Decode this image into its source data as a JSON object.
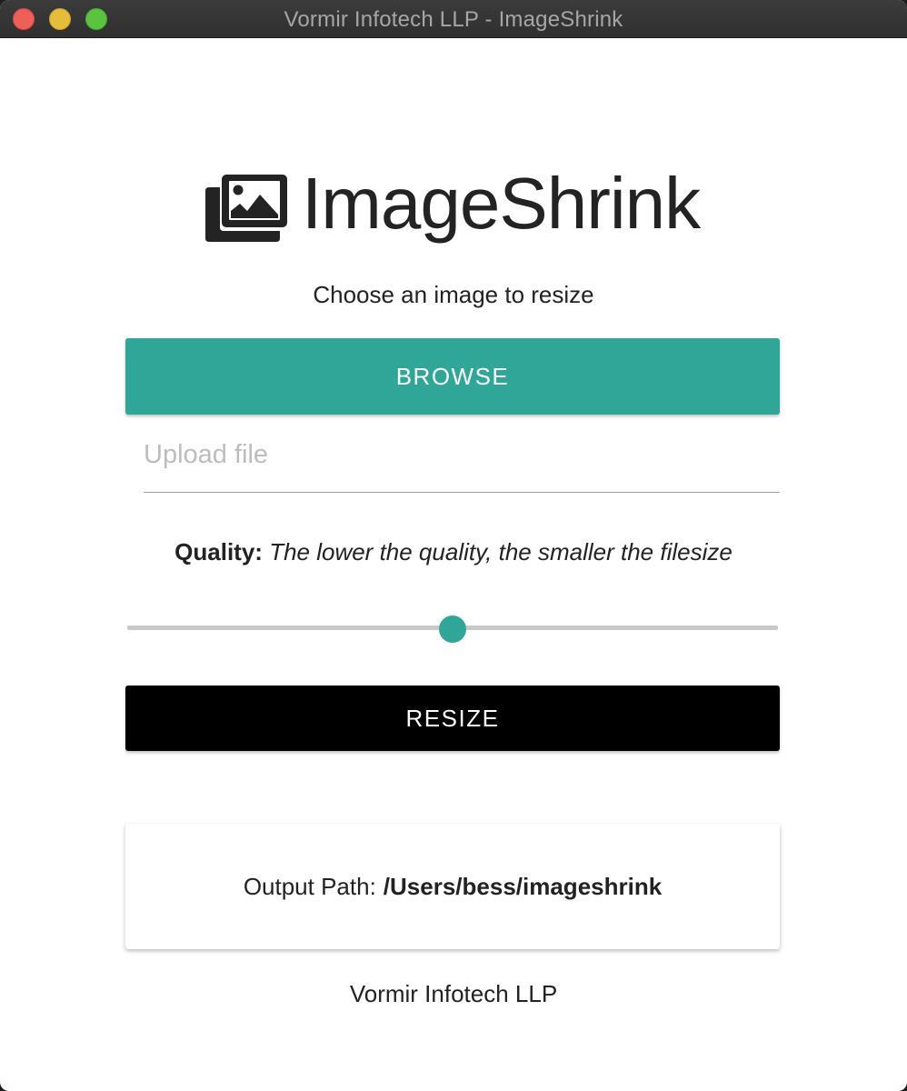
{
  "window": {
    "title": "Vormir Infotech LLP - ImageShrink"
  },
  "logo": {
    "icon": "images-icon",
    "text": "ImageShrink"
  },
  "subtitle": "Choose an image to resize",
  "browse_button": {
    "label": "BROWSE",
    "color": "#30a699"
  },
  "upload": {
    "placeholder": "Upload file",
    "value": ""
  },
  "quality": {
    "label": "Quality:",
    "hint": "The lower the quality, the smaller the filesize",
    "slider_value": 50,
    "slider_min": 0,
    "slider_max": 100
  },
  "resize_button": {
    "label": "RESIZE"
  },
  "output": {
    "label": "Output Path:",
    "path": "/Users/bess/imageshrink"
  },
  "footer": "Vormir Infotech LLP"
}
